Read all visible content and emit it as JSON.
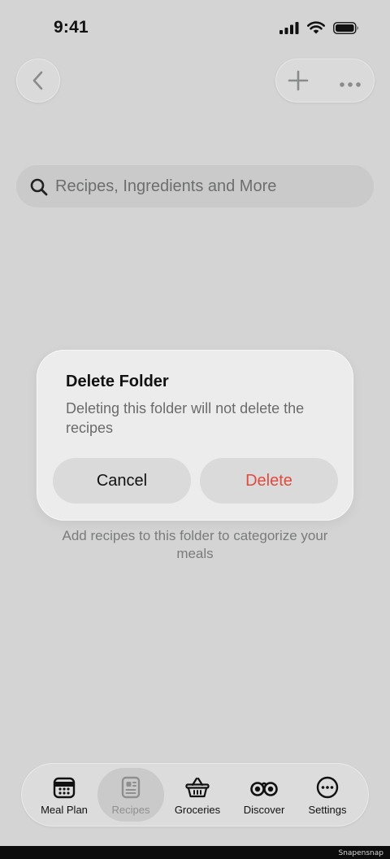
{
  "status_bar": {
    "time": "9:41"
  },
  "search": {
    "placeholder": "Recipes, Ingredients and More"
  },
  "empty_state": {
    "text": "Add recipes to this folder to categorize your meals"
  },
  "dialog": {
    "title": "Delete Folder",
    "message": "Deleting this folder will not delete the recipes",
    "cancel_label": "Cancel",
    "delete_label": "Delete",
    "delete_color": "#e04a3f"
  },
  "tabs": [
    {
      "label": "Meal Plan",
      "icon": "calendar-icon",
      "active": false
    },
    {
      "label": "Recipes",
      "icon": "recipe-card-icon",
      "active": true
    },
    {
      "label": "Groceries",
      "icon": "basket-icon",
      "active": false
    },
    {
      "label": "Discover",
      "icon": "binoculars-icon",
      "active": false
    },
    {
      "label": "Settings",
      "icon": "ellipsis-circle-icon",
      "active": false
    }
  ],
  "watermark": "Snapensnap"
}
